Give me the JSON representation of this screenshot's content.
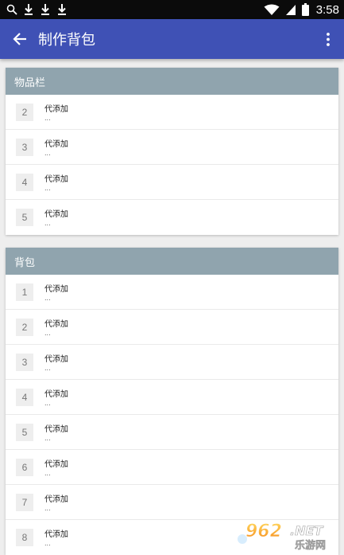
{
  "status_bar": {
    "time": "3:58",
    "left_icons": [
      "search-icon",
      "download-icon",
      "download-icon",
      "download-icon"
    ],
    "right_icons": [
      "wifi-icon",
      "signal-icon",
      "battery-icon"
    ]
  },
  "app_bar": {
    "title": "制作背包",
    "back_icon": "arrow-back-icon",
    "menu_icon": "more-vert-icon",
    "color": "#3f51b5"
  },
  "sections": [
    {
      "title": "物品栏",
      "header_color": "#90a4ae",
      "items": [
        {
          "number": "2",
          "name": "代添加",
          "sub": "..."
        },
        {
          "number": "3",
          "name": "代添加",
          "sub": "..."
        },
        {
          "number": "4",
          "name": "代添加",
          "sub": "..."
        },
        {
          "number": "5",
          "name": "代添加",
          "sub": "..."
        }
      ]
    },
    {
      "title": "背包",
      "header_color": "#90a4ae",
      "items": [
        {
          "number": "1",
          "name": "代添加",
          "sub": "..."
        },
        {
          "number": "2",
          "name": "代添加",
          "sub": "..."
        },
        {
          "number": "3",
          "name": "代添加",
          "sub": "..."
        },
        {
          "number": "4",
          "name": "代添加",
          "sub": "..."
        },
        {
          "number": "5",
          "name": "代添加",
          "sub": "..."
        },
        {
          "number": "6",
          "name": "代添加",
          "sub": "..."
        },
        {
          "number": "7",
          "name": "代添加",
          "sub": "..."
        },
        {
          "number": "8",
          "name": "代添加",
          "sub": "..."
        }
      ]
    }
  ],
  "watermark": {
    "number": "962",
    "suffix": ".NET",
    "text": "乐游网"
  }
}
